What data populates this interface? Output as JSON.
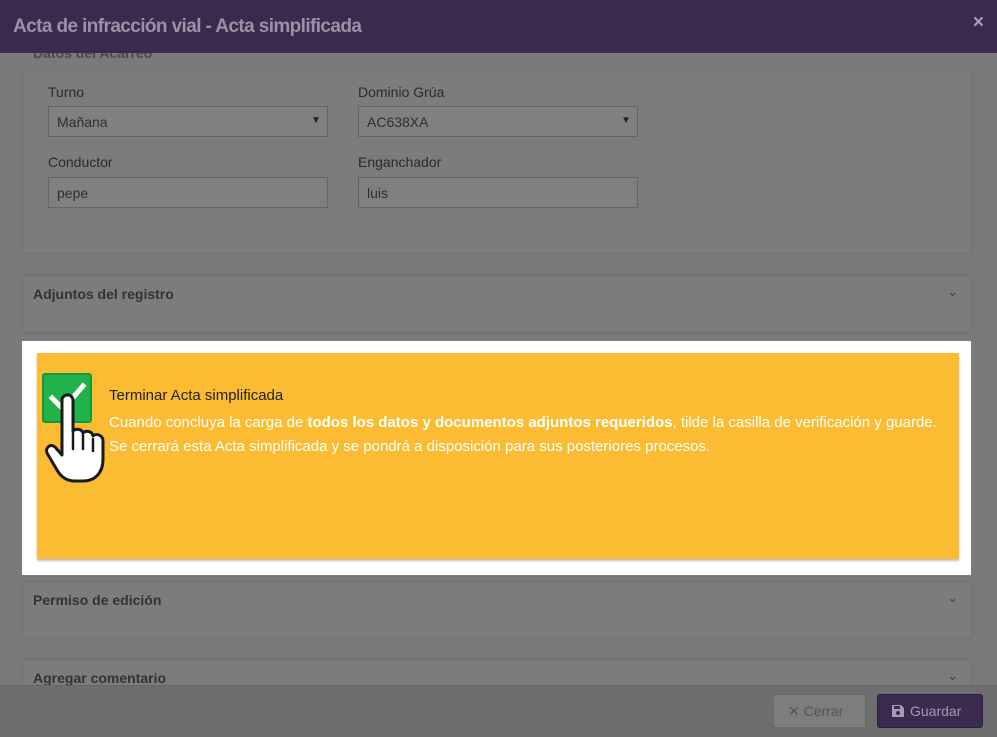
{
  "modal": {
    "title": "Acta de infracción vial - Acta simplificada",
    "close_glyph": "×"
  },
  "datos_acarreo": {
    "section_title": "Datos del Acarreo",
    "turno": {
      "label": "Turno",
      "value": "Mañana"
    },
    "dominio_grua": {
      "label": "Dominio Grúa",
      "value": "AC638XA"
    },
    "conductor": {
      "label": "Conductor",
      "value": "pepe"
    },
    "enganchador": {
      "label": "Enganchador",
      "value": "luis"
    }
  },
  "accordions": {
    "adjuntos": "Adjuntos del registro",
    "permiso": "Permiso de edición",
    "comentario": "Agregar comentario",
    "chevron_glyph": "⌄"
  },
  "notice": {
    "title": "Terminar Acta simplificada",
    "text_before": "Cuando concluya la carga de ",
    "text_bold": "todos los datos y documentos adjuntos requeridos",
    "text_after": ", tilde la casilla de verificación y guarde. Se cerrará esta Acta simplificada y se pondrá a disposición para sus posteriores procesos.",
    "checked": true
  },
  "footer": {
    "cerrar_label": "Cerrar",
    "guardar_label": "Guardar"
  },
  "colors": {
    "header": "#3b2a4e",
    "notice_bg": "#fbbc33",
    "checkbox": "#21b24b"
  },
  "icons": {
    "close": "close-icon",
    "dropdown": "caret-down-icon",
    "chevron": "chevron-down-icon",
    "check": "check-icon",
    "hand": "hand-pointer-icon",
    "save": "save-icon",
    "cancel": "times-icon"
  }
}
